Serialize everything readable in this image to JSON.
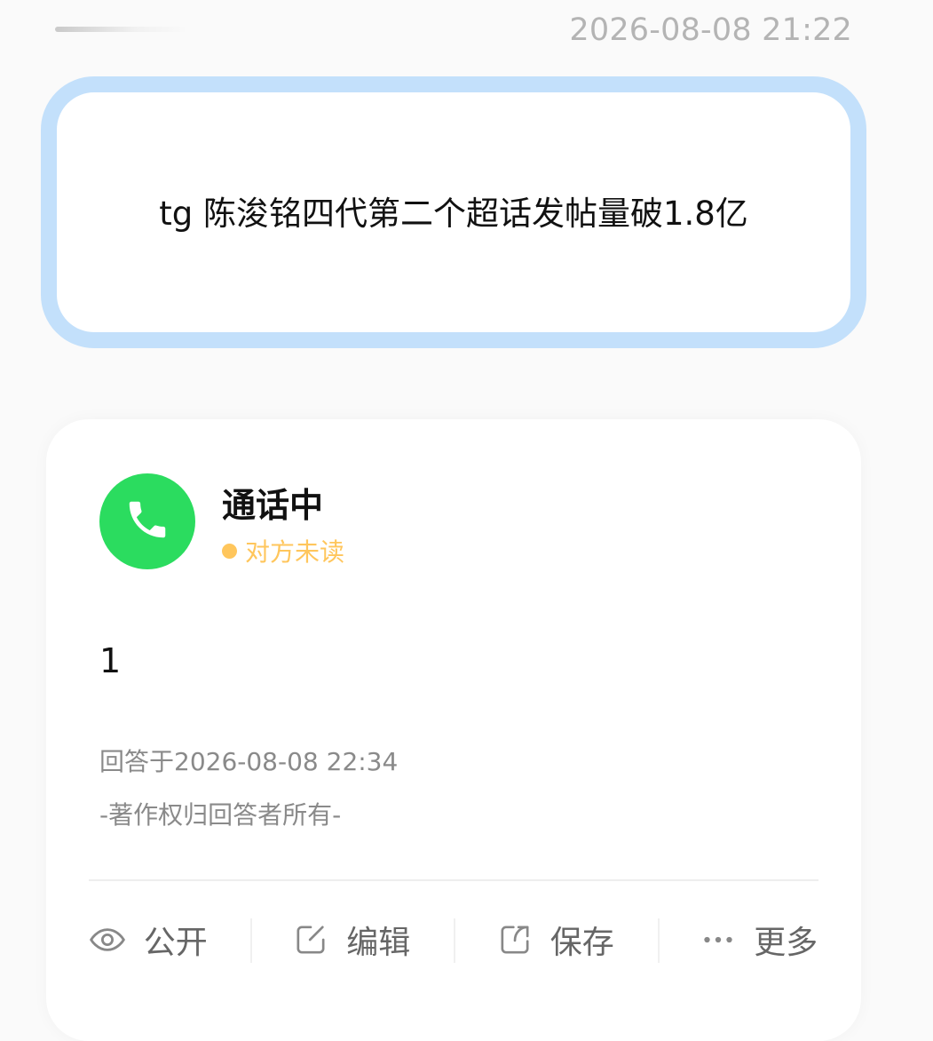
{
  "header": {
    "timestamp": "2026-08-08 21:22"
  },
  "question": {
    "text": "tg 陈浚铭四代第二个超话发帖量破1.8亿"
  },
  "answer": {
    "answerer_name": "通话中",
    "read_status": "对方未读",
    "status_color": "#ffc65c",
    "avatar_color": "#2bdc5f",
    "avatar_icon": "phone-icon",
    "content": "1",
    "answered_at": "回答于2026-08-08 22:34",
    "copyright": "-著作权归回答者所有-"
  },
  "actions": [
    {
      "label": "公开",
      "icon": "eye-icon"
    },
    {
      "label": "编辑",
      "icon": "edit-icon"
    },
    {
      "label": "保存",
      "icon": "share-icon"
    },
    {
      "label": "更多",
      "icon": "more-icon"
    }
  ]
}
